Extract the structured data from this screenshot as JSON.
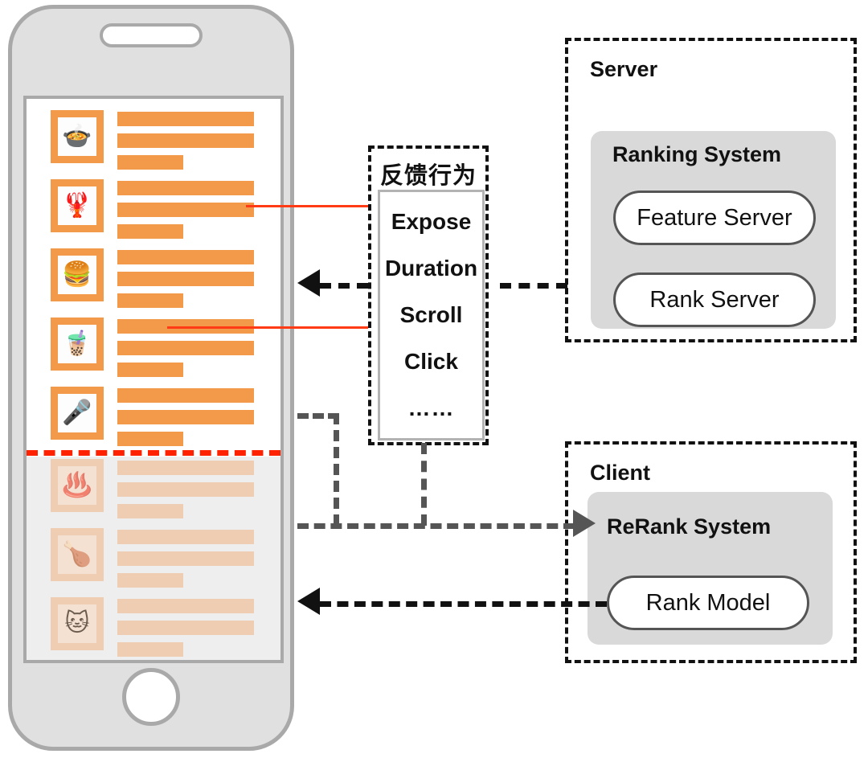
{
  "diagram": {
    "title": "Client-side re-ranking system architecture",
    "colors": {
      "accent_orange": "#F2994A",
      "faded_orange": "#EFCDB3",
      "red_line": "#FF3B15",
      "red_dashed": "#FF2200",
      "panel_gray": "#D9D9D9",
      "phone_body": "#E0E0E0",
      "phone_border": "#A9A9A9",
      "arrow_black": "#111111",
      "arrow_gray": "#555555"
    }
  },
  "phone": {
    "feed_visible": [
      {
        "icon": "hotpot-icon",
        "glyph": "🍲"
      },
      {
        "icon": "lobster-icon",
        "glyph": "🦞"
      },
      {
        "icon": "hamburger-icon",
        "glyph": "🍔"
      },
      {
        "icon": "bubble-tea-icon",
        "glyph": "🧋"
      },
      {
        "icon": "microphone-icon",
        "glyph": "🎤"
      }
    ],
    "feed_below_fold": [
      {
        "icon": "hot-springs-icon",
        "glyph": "♨️"
      },
      {
        "icon": "roast-chicken-icon",
        "glyph": "🍗"
      },
      {
        "icon": "cat-face-icon",
        "glyph": "🐱"
      }
    ]
  },
  "feedback_panel": {
    "title": "反馈行为",
    "items": [
      "Expose",
      "Duration",
      "Scroll",
      "Click",
      "……"
    ]
  },
  "server_panel": {
    "title": "Server",
    "system_title": "Ranking System",
    "components": [
      "Feature Server",
      "Rank Server"
    ]
  },
  "client_panel": {
    "title": "Client",
    "system_title": "ReRank System",
    "components": [
      "Rank Model"
    ]
  }
}
